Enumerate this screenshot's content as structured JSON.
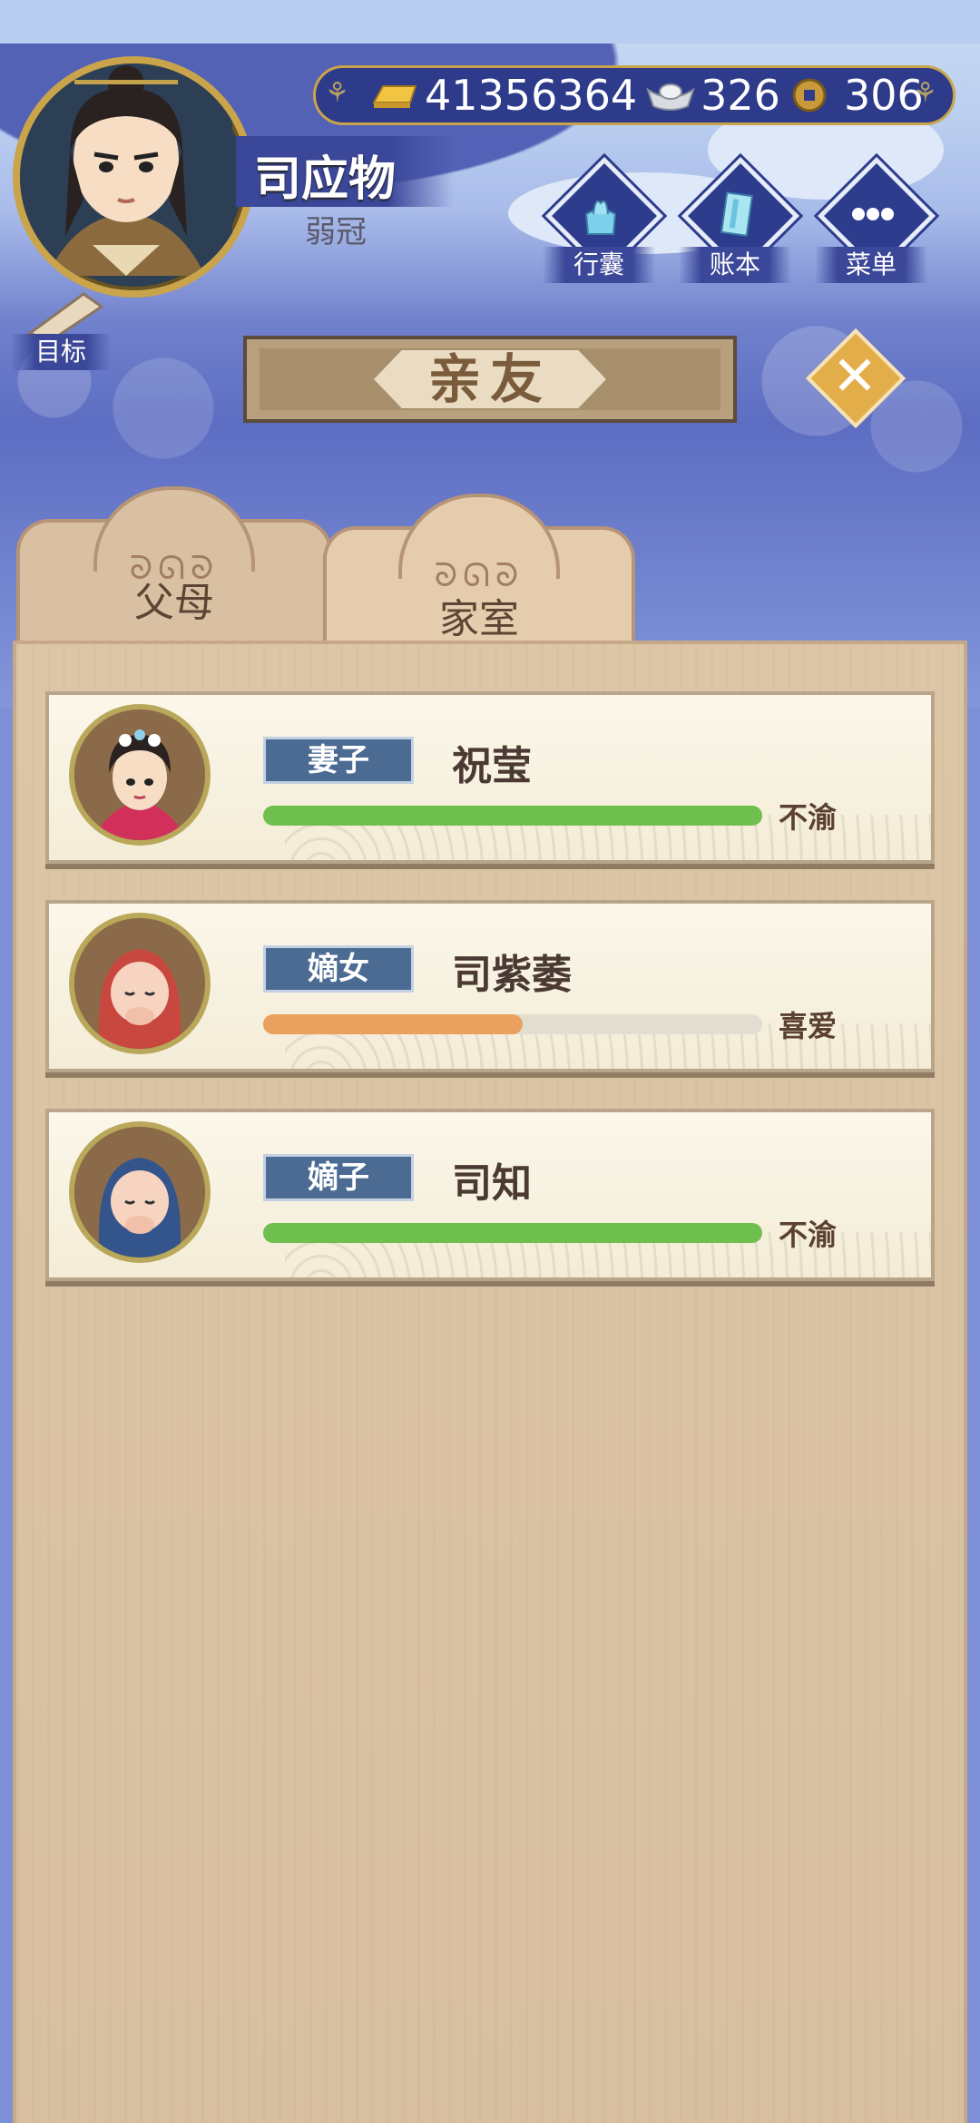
{
  "player": {
    "name": "司应物",
    "age_title": "弱冠"
  },
  "currency": {
    "gold": "41356364",
    "silver": "326",
    "coin": "306"
  },
  "menu": [
    {
      "label": "行囊",
      "icon": "bundle-icon"
    },
    {
      "label": "账本",
      "icon": "ledger-icon"
    },
    {
      "label": "菜单",
      "icon": "more-icon"
    }
  ],
  "target_label": "目标",
  "title": "亲友",
  "tabs": [
    {
      "label": "父母",
      "active": false
    },
    {
      "label": "家室",
      "active": true
    }
  ],
  "relatives": [
    {
      "relation": "妻子",
      "name": "祝莹",
      "favor": 1.0,
      "bar_color": "#6fbf4e",
      "attitude": "不渝"
    },
    {
      "relation": "嫡女",
      "name": "司紫萎",
      "favor": 0.52,
      "bar_color": "#eaa05e",
      "attitude": "喜爱"
    },
    {
      "relation": "嫡子",
      "name": "司知",
      "favor": 1.0,
      "bar_color": "#6fbf4e",
      "attitude": "不渝"
    }
  ],
  "colors": {
    "badge_blue": "#4b6b93",
    "panel_wood": "#d9c1a2",
    "frame_gold": "#c9a44a"
  }
}
